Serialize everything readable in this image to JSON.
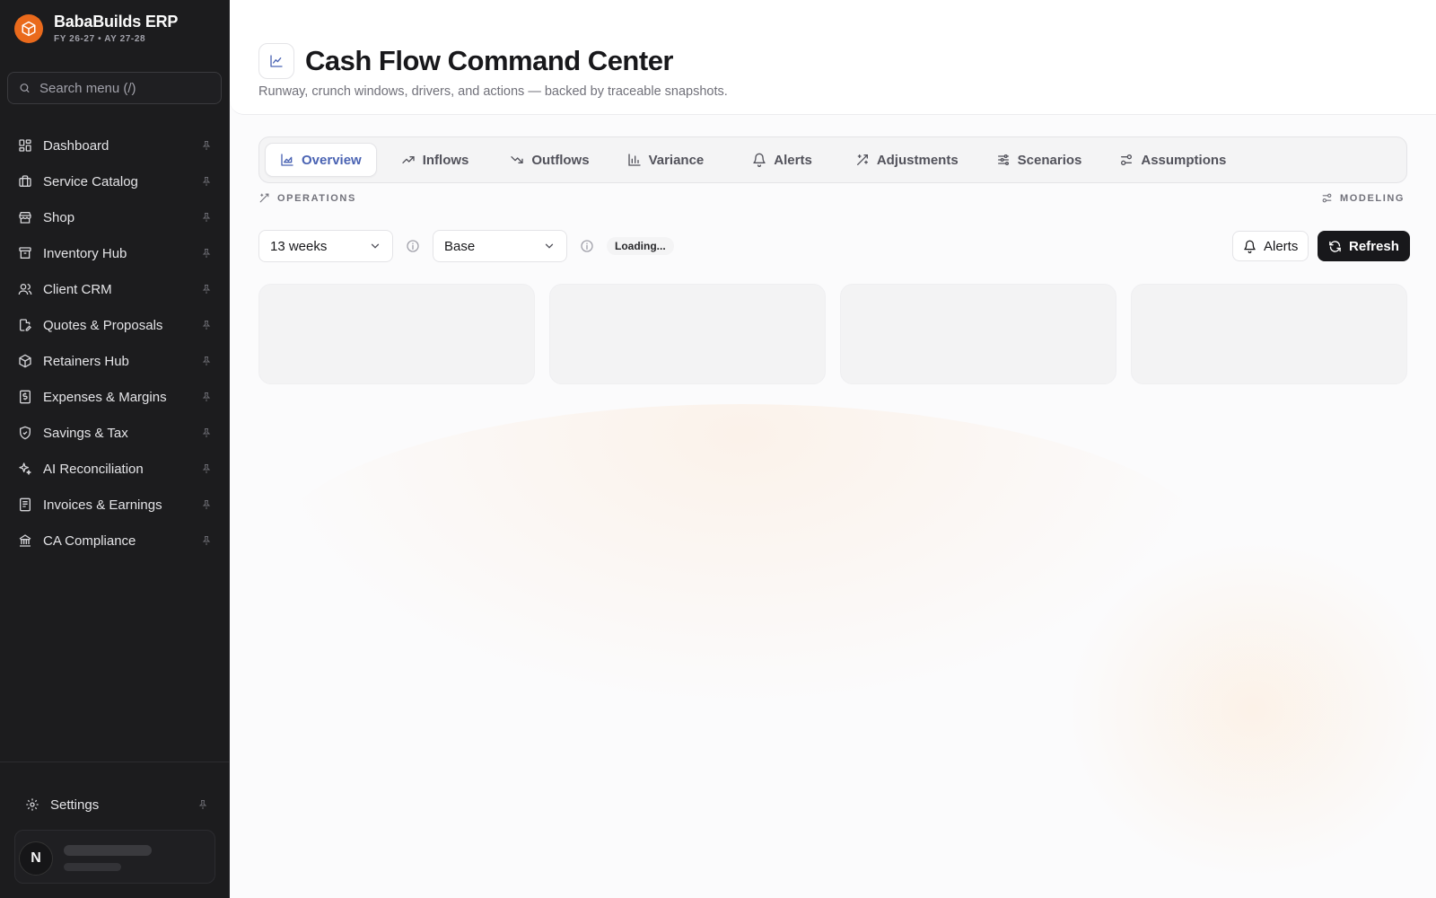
{
  "brand": {
    "name": "BabaBuilds ERP",
    "subtitle": "FY 26-27 • AY 27-28",
    "accent": "#ea6a1c"
  },
  "search": {
    "placeholder": "Search menu (/)",
    "icon": "search-icon"
  },
  "sidebar": {
    "items": [
      {
        "label": "Dashboard",
        "icon": "layout-dashboard-icon"
      },
      {
        "label": "Service Catalog",
        "icon": "briefcase-icon"
      },
      {
        "label": "Shop",
        "icon": "store-icon"
      },
      {
        "label": "Inventory Hub",
        "icon": "archive-icon"
      },
      {
        "label": "Client CRM",
        "icon": "users-icon"
      },
      {
        "label": "Quotes & Proposals",
        "icon": "file-edit-icon"
      },
      {
        "label": "Retainers Hub",
        "icon": "package-icon"
      },
      {
        "label": "Expenses & Margins",
        "icon": "receipt-icon"
      },
      {
        "label": "Savings & Tax",
        "icon": "shield-icon"
      },
      {
        "label": "AI Reconciliation",
        "icon": "sparkles-icon"
      },
      {
        "label": "Invoices & Earnings",
        "icon": "file-text-icon"
      },
      {
        "label": "CA Compliance",
        "icon": "landmark-icon"
      }
    ],
    "settings": {
      "label": "Settings",
      "icon": "gear-icon"
    },
    "user": {
      "avatar_initial": "N"
    }
  },
  "header": {
    "title": "Cash Flow Command Center",
    "subtitle": "Runway, crunch windows, drivers, and actions — backed by traceable snapshots.",
    "icon": "line-chart-icon"
  },
  "tabs": [
    {
      "label": "Overview",
      "icon": "area-chart-icon",
      "active": true
    },
    {
      "label": "Inflows",
      "icon": "trending-up-icon",
      "active": false
    },
    {
      "label": "Outflows",
      "icon": "trending-down-icon",
      "active": false
    },
    {
      "label": "Variance",
      "icon": "bar-chart-icon",
      "active": false
    },
    {
      "label": "Alerts",
      "icon": "bell-icon",
      "active": false
    },
    {
      "label": "Adjustments",
      "icon": "wand-icon",
      "active": false
    },
    {
      "label": "Scenarios",
      "icon": "sliders-icon",
      "active": false
    },
    {
      "label": "Assumptions",
      "icon": "settings-2-icon",
      "active": false
    }
  ],
  "sections": {
    "left": "OPERATIONS",
    "right": "MODELING"
  },
  "toolbar": {
    "horizon": {
      "value": "13 weeks"
    },
    "scenario": {
      "value": "Base"
    },
    "status": "Loading...",
    "alerts_label": "Alerts",
    "refresh_label": "Refresh"
  },
  "colors": {
    "sidebar_bg": "#1c1c1e",
    "active_tab": "#4a63b3",
    "primary_button": "#18181b"
  }
}
